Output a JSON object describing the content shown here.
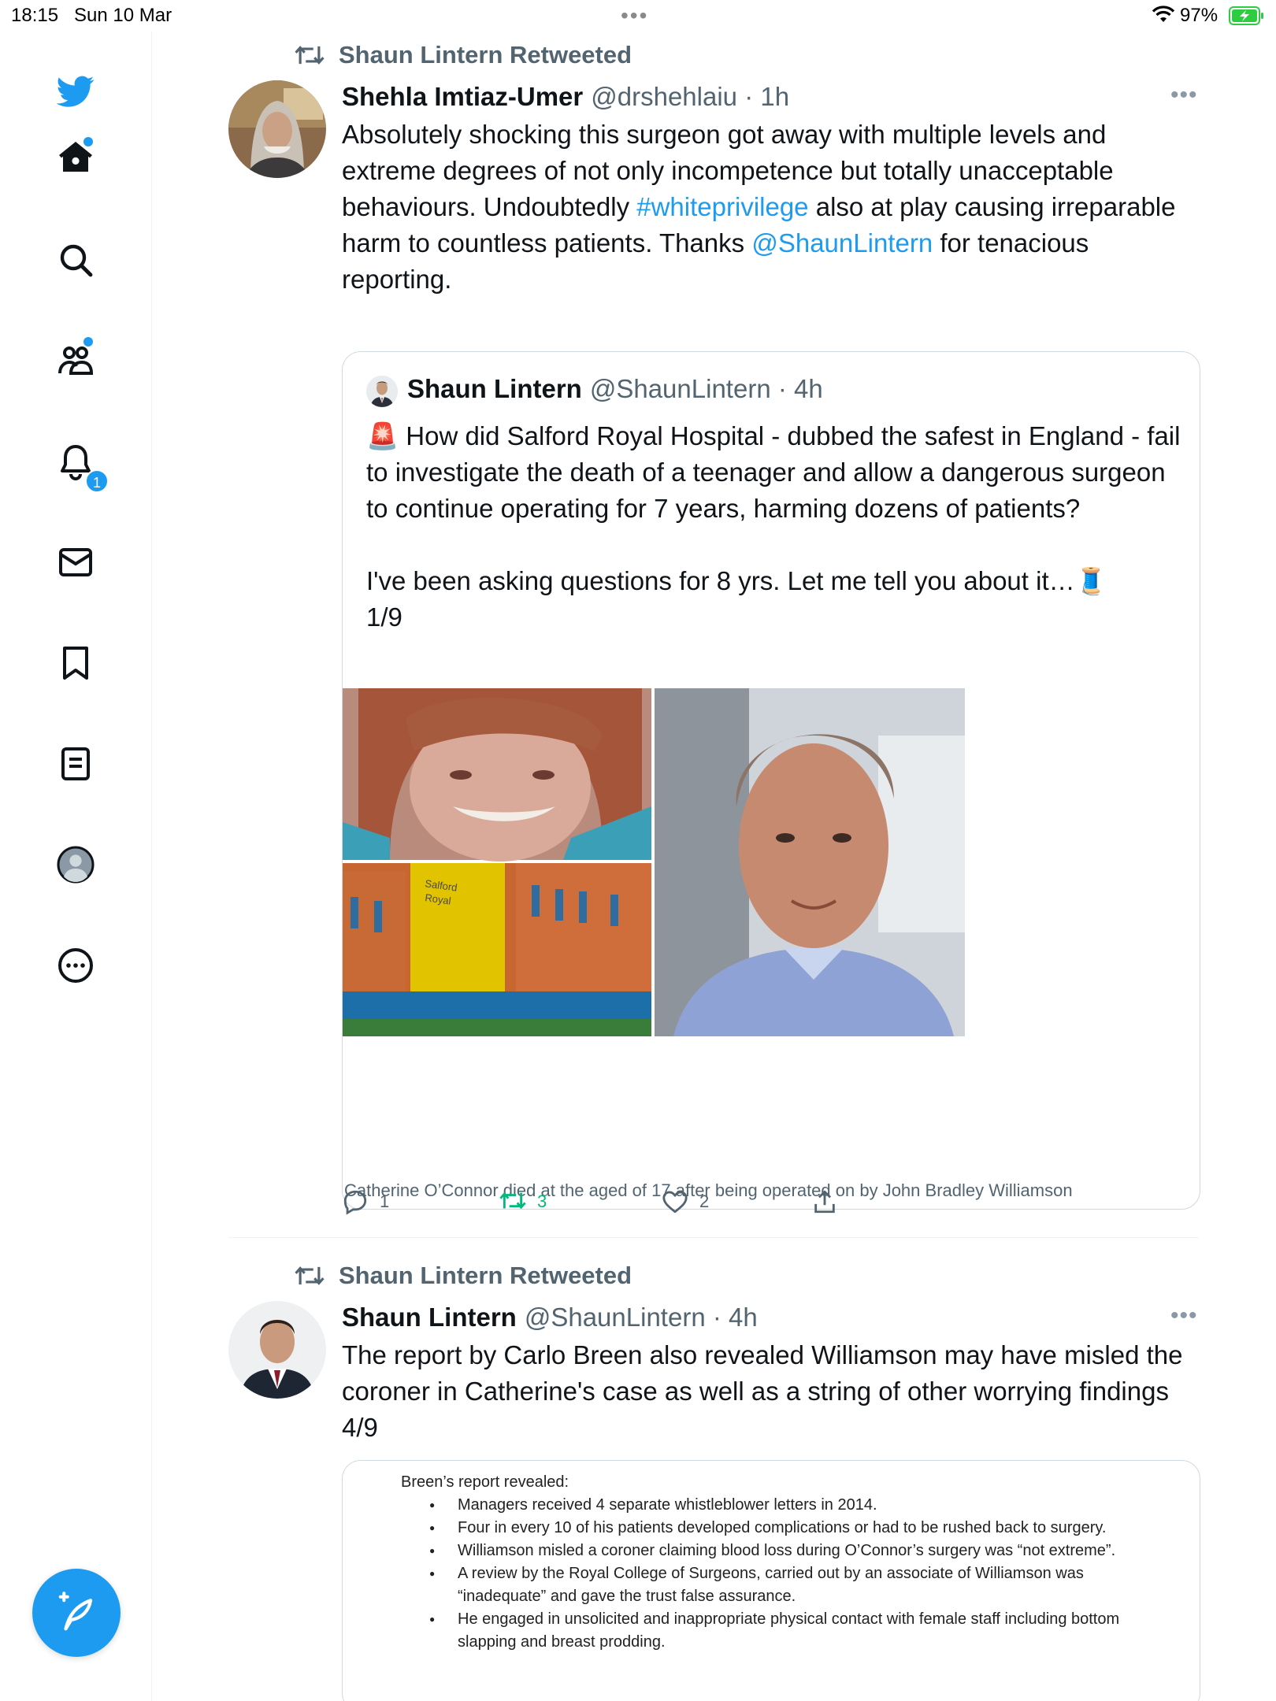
{
  "status_bar": {
    "time": "18:15",
    "date": "Sun 10 Mar",
    "dots": "•••",
    "battery_percent": "97%"
  },
  "sidebar": {
    "items": [
      {
        "icon": "twitter-bird-icon"
      },
      {
        "icon": "home-icon",
        "has_dot": true
      },
      {
        "icon": "search-icon"
      },
      {
        "icon": "communities-icon",
        "has_dot": true
      },
      {
        "icon": "notifications-icon",
        "badge": "1"
      },
      {
        "icon": "messages-icon"
      },
      {
        "icon": "bookmarks-icon"
      },
      {
        "icon": "lists-icon"
      },
      {
        "icon": "profile-icon"
      },
      {
        "icon": "more-icon"
      }
    ],
    "notification_badge": "1",
    "compose_icon": "compose-tweet-icon"
  },
  "tweet1": {
    "retweet_label": "Shaun Lintern Retweeted",
    "name": "Shehla Imtiaz-Umer",
    "handle": "@drshehlaiu · 1h",
    "text_parts": {
      "a": "Absolutely shocking this surgeon got away with multiple levels and extreme degrees of not only incompetence but totally unacceptable behaviours. Undoubtedly ",
      "hashtag": "#whiteprivilege",
      "b": " also at play causing irreparable harm to countless patients. Thanks ",
      "mention": "@ShaunLintern",
      "c": " for tenacious reporting."
    },
    "quote": {
      "name": "Shaun Lintern",
      "handle": "@ShaunLintern · 4h",
      "text": "🚨 How did Salford Royal Hospital - dubbed the safest in England - fail to investigate the death of a teenager and allow a dangerous surgeon to continue operating for 7 years, harming dozens of patients?\n\nI've been asking questions for 8 yrs. Let me tell you about it…🧵\n1/9",
      "sign_text": "Salford Royal",
      "caption": "Catherine O’Connor died at the aged of 17 after being operated on by John Bradley Williamson"
    },
    "actions": {
      "replies": "1",
      "retweets": "3",
      "likes": "2"
    }
  },
  "tweet2": {
    "retweet_label": "Shaun Lintern Retweeted",
    "name": "Shaun Lintern",
    "handle": "@ShaunLintern · 4h",
    "text": "The report by Carlo Breen also revealed Williamson may have misled the coroner in Catherine's case as well as a string of other worrying findings 4/9",
    "image": {
      "title": "Breen’s report revealed:",
      "bullets": [
        "Managers received 4 separate whistleblower letters in 2014.",
        "Four in every 10 of his patients developed complications or had to be rushed back to surgery.",
        "Williamson misled a coroner claiming blood loss during O’Connor’s surgery was “not extreme”.",
        "A review by the Royal College of Surgeons, carried out by an associate of Williamson was “inadequate” and gave the trust false assurance.",
        "He engaged in unsolicited and inappropriate physical contact with female staff including bottom slapping and breast prodding."
      ]
    }
  },
  "colors": {
    "accent": "#1d9bf0",
    "retweet_green": "#00ba7c",
    "secondary_text": "#536471",
    "border": "#cfd9de"
  }
}
